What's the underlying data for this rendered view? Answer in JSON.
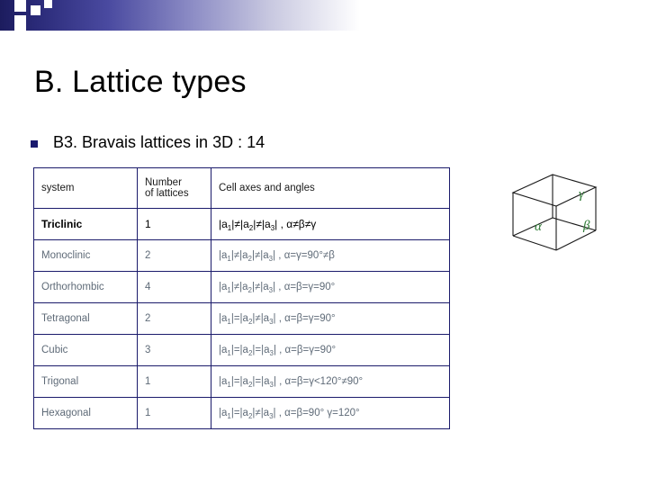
{
  "slide": {
    "title": "B. Lattice types",
    "bullet": "B3. Bravais lattices in 3D : 14"
  },
  "table": {
    "headers": [
      "system",
      "Number\nof lattices",
      "Cell axes and angles"
    ],
    "header_col1": "system",
    "header_col2_line1": "Number",
    "header_col2_line2": "of lattices",
    "header_col3": "Cell axes and angles",
    "rows": [
      {
        "system": "Triclinic",
        "count": "1",
        "axes_prefix": "|a",
        "axes": "|a1|≠|a2|≠|a3| , α≠β≠γ",
        "parts": [
          "|a",
          "1",
          "|≠|a",
          "2",
          "|≠|a",
          "3",
          "| , α≠β≠γ"
        ]
      },
      {
        "system": "Monoclinic",
        "count": "2",
        "axes": "|a1|≠|a2|≠|a3| , α=γ=90°≠β",
        "parts": [
          "|a",
          "1",
          "|≠|a",
          "2",
          "|≠|a",
          "3",
          "| , α=γ=90°≠β"
        ]
      },
      {
        "system": "Orthorhombic",
        "count": "4",
        "axes": "|a1|≠|a2|≠|a3| , α=β=γ=90°",
        "parts": [
          "|a",
          "1",
          "|≠|a",
          "2",
          "|≠|a",
          "3",
          "| , α=β=γ=90°"
        ]
      },
      {
        "system": "Tetragonal",
        "count": "2",
        "axes": "|a1|=|a2|≠|a3| , α=β=γ=90°",
        "parts": [
          "|a",
          "1",
          "|=|a",
          "2",
          "|≠|a",
          "3",
          "| , α=β=γ=90°"
        ]
      },
      {
        "system": "Cubic",
        "count": "3",
        "axes": "|a1|=|a2|=|a3| , α=β=γ=90°",
        "parts": [
          "|a",
          "1",
          "|=|a",
          "2",
          "|=|a",
          "3",
          "| , α=β=γ=90°"
        ]
      },
      {
        "system": "Trigonal",
        "count": "1",
        "axes": "|a1|=|a2|=|a3| , α=β=γ<120°≠90°",
        "parts": [
          "|a",
          "1",
          "|=|a",
          "2",
          "|=|a",
          "3",
          "| , α=β=γ<120°≠90°"
        ]
      },
      {
        "system": "Hexagonal",
        "count": "1",
        "axes": "|a1|=|a2|≠|a3| , α=β=90° γ=120°",
        "parts": [
          "|a",
          "1",
          "|=|a",
          "2",
          "|≠|a",
          "3",
          "| , α=β=90° γ=120°"
        ]
      }
    ]
  },
  "diagram": {
    "name": "unit-cell-parallelepiped",
    "labels": {
      "gamma": "γ",
      "beta": "β",
      "alpha": "α"
    },
    "label_color": "#2f7a36",
    "edge_color": "#1a1a1a"
  },
  "colors": {
    "bullet_marker": "#1a1a6e",
    "table_border": "#1b1b6b",
    "table_text_muted": "#5f6b78",
    "title_text": "#000000"
  }
}
